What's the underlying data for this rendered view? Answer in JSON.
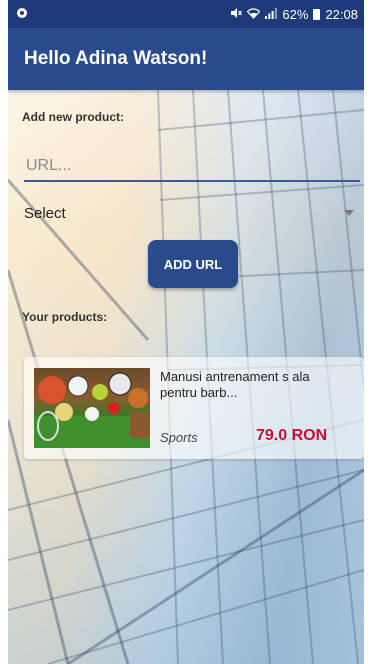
{
  "status_bar": {
    "battery": "62%",
    "time": "22:08"
  },
  "app_bar": {
    "title": "Hello Adina Watson!"
  },
  "add_product": {
    "label": "Add new product:",
    "url_placeholder": "URL...",
    "url_value": "",
    "select_value": "Select",
    "add_button_label": "ADD URL"
  },
  "products_section": {
    "label": "Your products:",
    "items": [
      {
        "name": "Manusi antrenament s ala pentru barb...",
        "category": "Sports",
        "price": "79.0 RON"
      }
    ]
  },
  "colors": {
    "primary": "#2a4a8e",
    "status_bar": "#1f3a7a",
    "price": "#c8102e"
  }
}
